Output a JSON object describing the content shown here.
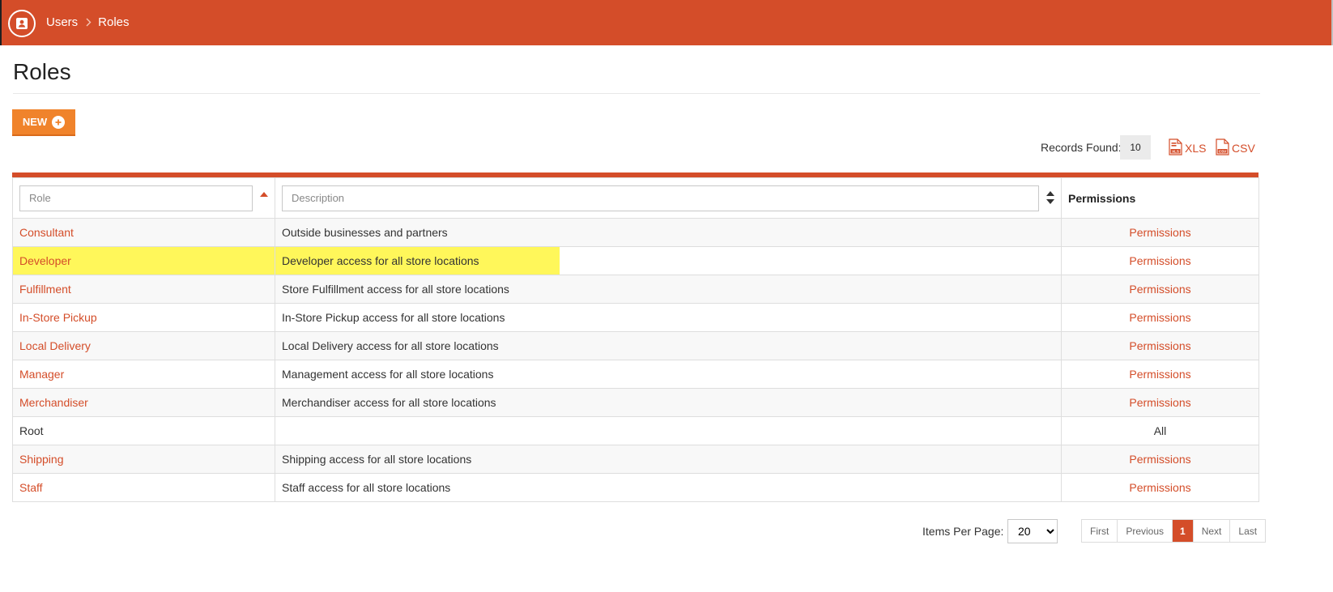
{
  "colors": {
    "brand": "#d44d29",
    "new_button": "#f0832b",
    "highlight": "#fff75a"
  },
  "header": {
    "icon": "user-badge-icon",
    "breadcrumb": [
      "Users",
      "Roles"
    ]
  },
  "page": {
    "title": "Roles"
  },
  "toolbar": {
    "new_label": "NEW",
    "records_label": "Records Found:",
    "records_count": "10",
    "export_xls": "XLS",
    "export_csv": "CSV"
  },
  "table": {
    "role_placeholder": "Role",
    "description_placeholder": "Description",
    "permissions_header": "Permissions",
    "rows": [
      {
        "role": "Consultant",
        "description": "Outside businesses and partners",
        "permissions": "Permissions"
      },
      {
        "role": "Developer",
        "description": "Developer access for all store locations",
        "permissions": "Permissions"
      },
      {
        "role": "Fulfillment",
        "description": "Store Fulfillment access for all store locations",
        "permissions": "Permissions"
      },
      {
        "role": "In-Store Pickup",
        "description": "In-Store Pickup access for all store locations",
        "permissions": "Permissions"
      },
      {
        "role": "Local Delivery",
        "description": "Local Delivery access for all store locations",
        "permissions": "Permissions"
      },
      {
        "role": "Manager",
        "description": "Management access for all store locations",
        "permissions": "Permissions"
      },
      {
        "role": "Merchandiser",
        "description": "Merchandiser access for all store locations",
        "permissions": "Permissions"
      },
      {
        "role": "Root",
        "description": "",
        "permissions": "All"
      },
      {
        "role": "Shipping",
        "description": "Shipping access for all store locations",
        "permissions": "Permissions"
      },
      {
        "role": "Staff",
        "description": "Staff access for all store locations",
        "permissions": "Permissions"
      }
    ]
  },
  "footer": {
    "items_per_page_label": "Items Per Page:",
    "items_per_page_value": "20",
    "pager": {
      "first": "First",
      "previous": "Previous",
      "current": "1",
      "next": "Next",
      "last": "Last"
    }
  }
}
